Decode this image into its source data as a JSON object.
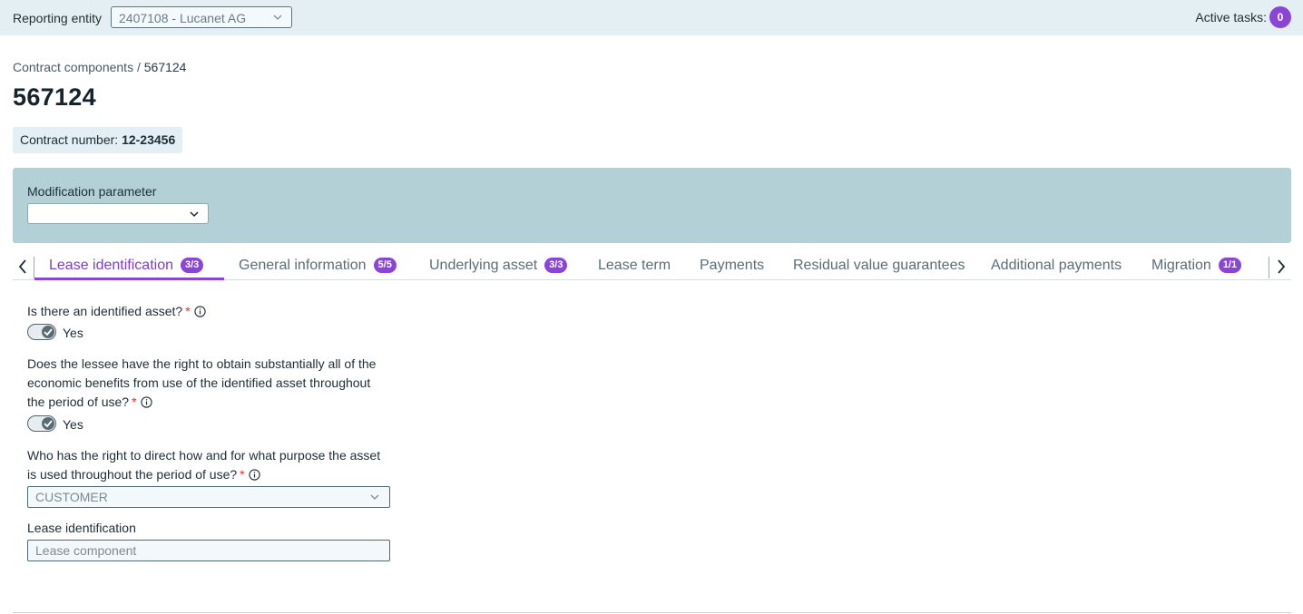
{
  "header": {
    "entity_label": "Reporting entity",
    "entity_value": "2407108 - Lucanet AG",
    "active_tasks_label": "Active tasks:",
    "active_tasks_count": "0"
  },
  "breadcrumb": {
    "parent": "Contract components",
    "separator": " / ",
    "current": "567124"
  },
  "page_title": "567124",
  "contract": {
    "label": "Contract number: ",
    "value": "12-23456"
  },
  "modification": {
    "label": "Modification parameter",
    "value": ""
  },
  "tabs": [
    {
      "label": "Lease identification",
      "badge": "3/3",
      "active": true
    },
    {
      "label": "General information",
      "badge": "5/5"
    },
    {
      "label": "Underlying asset",
      "badge": "3/3"
    },
    {
      "label": "Lease term",
      "badge": ""
    },
    {
      "label": "Payments",
      "badge": ""
    },
    {
      "label": "Residual value guarantees",
      "badge": ""
    },
    {
      "label": "Additional payments",
      "badge": ""
    },
    {
      "label": "Migration",
      "badge": "1/1"
    }
  ],
  "form": {
    "q1": {
      "label": "Is there an identified asset?",
      "required": "*",
      "toggle_value": "Yes"
    },
    "q2": {
      "label": "Does the lessee have the right to obtain substantially all of the economic benefits from use of the identified asset throughout the period of use?",
      "required": "*",
      "toggle_value": "Yes"
    },
    "q3": {
      "label": "Who has the right to direct how and for what purpose the asset is used throughout the period of use?",
      "required": "*",
      "value": "CUSTOMER"
    },
    "q4": {
      "label": "Lease identification",
      "placeholder": "Lease component"
    }
  },
  "colors": {
    "accent": "#8b45d6",
    "header_bg": "#e4eff3",
    "panel_bg": "#b3d0d6",
    "required": "#d0352f"
  }
}
